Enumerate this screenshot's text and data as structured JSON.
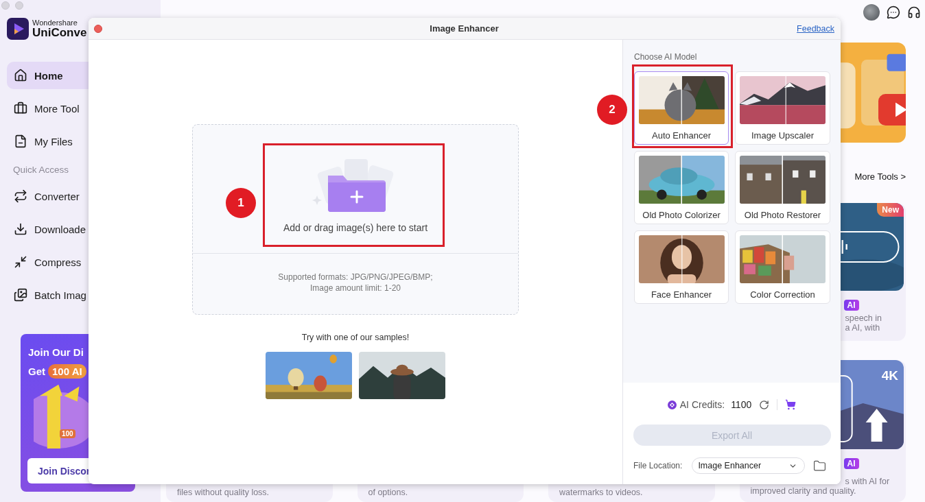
{
  "sidebar": {
    "brand_small": "Wondershare",
    "brand_name": "UniConve",
    "nav": [
      {
        "kind": "home",
        "label": "Home",
        "selected": true
      },
      {
        "kind": "toolbox",
        "label": "More Tool",
        "selected": false
      },
      {
        "kind": "files",
        "label": "My Files",
        "selected": false
      }
    ],
    "section_label": "Quick Access",
    "quick_access": [
      {
        "kind": "converter",
        "label": "Converter",
        "selected": false
      },
      {
        "kind": "download",
        "label": "Downloade",
        "selected": false
      },
      {
        "kind": "compress",
        "label": "Compress",
        "selected": false
      },
      {
        "kind": "batch",
        "label": "Batch Imag",
        "selected": false
      }
    ],
    "promo": {
      "title": "Join Our Di",
      "prefix": "Get",
      "badge": "100 AI",
      "tag": "100",
      "button": "Join Discor"
    }
  },
  "home": {
    "more_tools_link": "More Tools >",
    "feature_card": {
      "badge": "New",
      "tag": "AI",
      "lines": [
        "speech in",
        "a AI, with"
      ]
    },
    "captions": [
      "files without quality loss.",
      "of options.",
      "watermarks to videos."
    ],
    "upscale_card": {
      "label": "4K",
      "tag": "AI",
      "lines": [
        "s with AI for",
        "improved clarity and quality."
      ]
    }
  },
  "modal": {
    "title": "Image Enhancer",
    "feedback": "Feedback",
    "upload": {
      "prompt": "Add or drag image(s) here to start",
      "formats": "Supported formats: JPG/PNG/JPEG/BMP;",
      "limit": "Image amount limit: 1-20"
    },
    "samples_label": "Try with one of our samples!",
    "models_label": "Choose AI Model",
    "models": [
      {
        "label": "Auto Enhancer",
        "selected": true
      },
      {
        "label": "Image Upscaler",
        "selected": false
      },
      {
        "label": "Old Photo Colorizer",
        "selected": false
      },
      {
        "label": "Old Photo Restorer",
        "selected": false
      },
      {
        "label": "Face Enhancer",
        "selected": false
      },
      {
        "label": "Color Correction",
        "selected": false
      }
    ],
    "credits": {
      "label": "AI Credits:",
      "value": "1100"
    },
    "export": {
      "label": "Export All",
      "disabled": true
    },
    "location": {
      "label": "File Location:",
      "value": "Image Enhancer"
    }
  },
  "annotations": [
    {
      "number": "1"
    },
    {
      "number": "2"
    }
  ]
}
